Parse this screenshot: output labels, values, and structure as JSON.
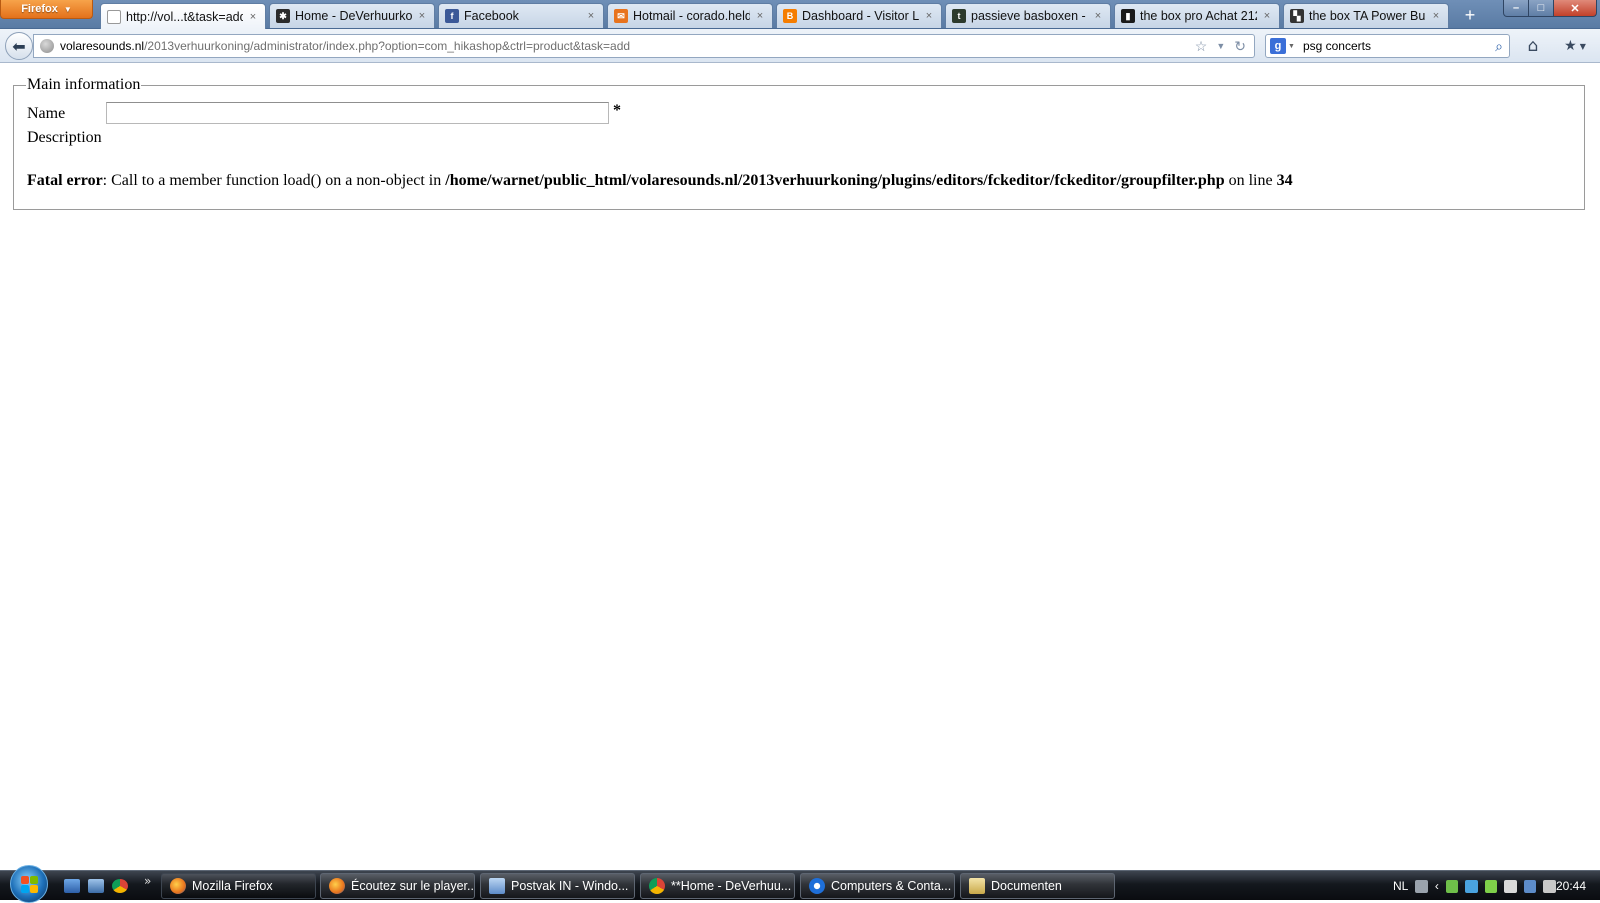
{
  "browser": {
    "menu_button": "Firefox",
    "tabs": [
      {
        "label": "http://vol...t&task=add",
        "favicon": "blank-page-icon",
        "color": "#ffffff"
      },
      {
        "label": "Home - DeVerhuurko...",
        "favicon": "joomla-icon",
        "color": "#2b2b2b"
      },
      {
        "label": "Facebook",
        "favicon": "facebook-icon",
        "color": "#3b5998"
      },
      {
        "label": "Hotmail - corado.held...",
        "favicon": "hotmail-icon",
        "color": "#e8731d"
      },
      {
        "label": "Dashboard - Visitor Li...",
        "favicon": "blogger-icon",
        "color": "#f57d00"
      },
      {
        "label": "passieve basboxen - T...",
        "favicon": "tweakers-icon",
        "color": "#2c3a2c"
      },
      {
        "label": "the box pro Achat 212...",
        "favicon": "speaker-icon",
        "color": "#1a1a1a"
      },
      {
        "label": "the box TA Power Bun...",
        "favicon": "thomann-icon",
        "color": "#333333"
      }
    ],
    "tab_close": "×",
    "new_tab": "+",
    "window_controls": {
      "minimize": "–",
      "maximize": "□",
      "close": "✕"
    },
    "address": {
      "domain": "volaresounds.nl",
      "path": "/2013verhuurkoning/administrator/index.php?option=com_hikashop&ctrl=product&task=add"
    },
    "search": {
      "engine": "Google",
      "value": "psg concerts"
    }
  },
  "page": {
    "legend": "Main information",
    "name_label": "Name",
    "name_value": "",
    "required_mark": "*",
    "description_label": "Description",
    "error": {
      "prefix": "Fatal error",
      "message": ": Call to a member function load() on a non-object in ",
      "file": "/home/warnet/public_html/volaresounds.nl/2013verhuurkoning/plugins/editors/fckeditor/fckeditor/groupfilter.php",
      "line_text": " on line ",
      "line": "34"
    }
  },
  "taskbar": {
    "quick_launch_more": "»",
    "buttons": [
      {
        "label": "Mozilla Firefox",
        "icon": "firefox-icon",
        "color": "#e8731d"
      },
      {
        "label": "Écoutez sur le player...",
        "icon": "firefox-icon",
        "color": "#e8731d"
      },
      {
        "label": "Postvak IN - Windo...",
        "icon": "mail-icon",
        "color": "#5d8cc9"
      },
      {
        "label": "**Home - DeVerhuu...",
        "icon": "chrome-icon",
        "color": "#4caf50"
      },
      {
        "label": "Computers & Conta...",
        "icon": "teamviewer-icon",
        "color": "#1e6fd9"
      },
      {
        "label": "Documenten",
        "icon": "folder-icon",
        "color": "#d9c27a"
      }
    ],
    "tray": {
      "language": "NL",
      "clock": "20:44"
    }
  }
}
